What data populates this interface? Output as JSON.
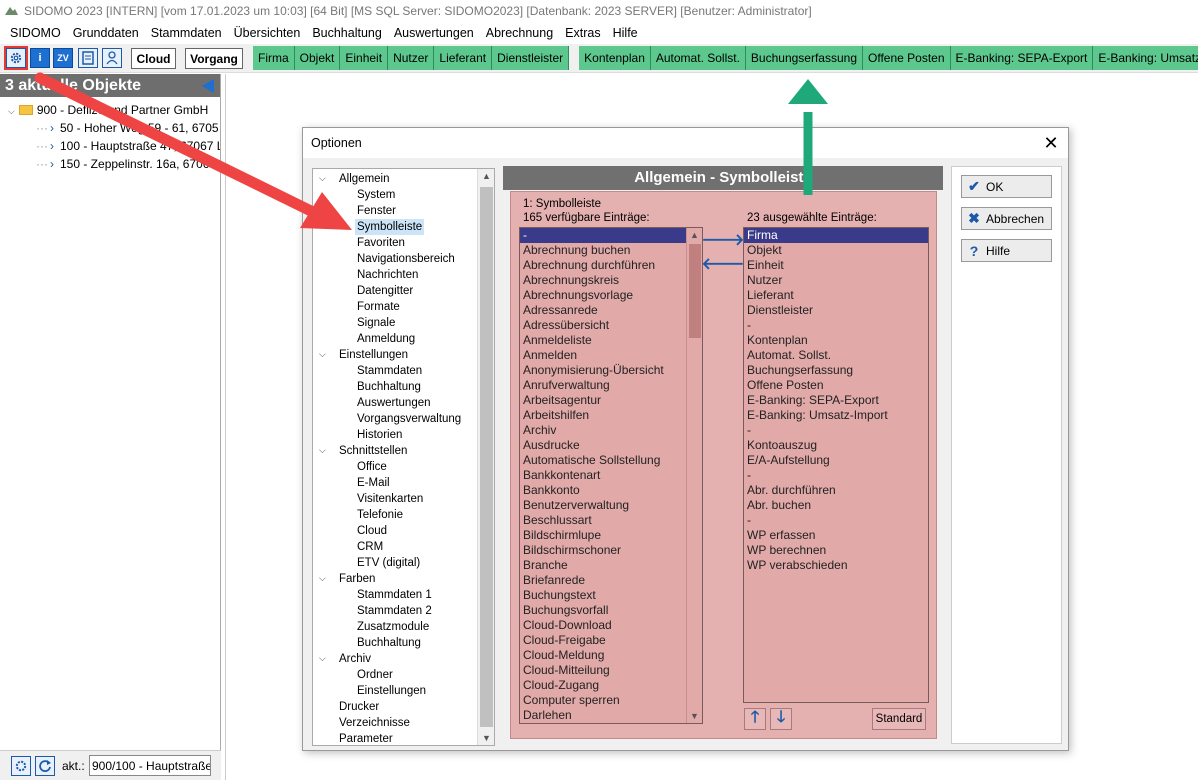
{
  "window": {
    "title": "SIDOMO 2023  [INTERN]  [vom 17.01.2023 um 10:03]  [64 Bit]  [MS SQL Server: SIDOMO2023]  [Datenbank: 2023 SERVER]  [Benutzer: Administrator]"
  },
  "menu": [
    "SIDOMO",
    "Grunddaten",
    "Stammdaten",
    "Übersichten",
    "Buchhaltung",
    "Auswertungen",
    "Abrechnung",
    "Extras",
    "Hilfe"
  ],
  "toolbar": {
    "icon_buttons": [
      {
        "icon": "gear-icon"
      },
      {
        "icon": "info-icon",
        "label": "i"
      },
      {
        "icon": "zv-icon",
        "label": "ZV"
      },
      {
        "icon": "calculator-icon"
      },
      {
        "icon": "user-icon"
      }
    ],
    "cloud_label": "Cloud",
    "vorgang_label": "Vorgang",
    "green_buttons": [
      "Firma",
      "Objekt",
      "Einheit",
      "Nutzer",
      "Lieferant",
      "Dienstleister",
      "-",
      "Kontenplan",
      "Automat. Sollst.",
      "Buchungserfassung",
      "Offene Posten",
      "E-Banking: SEPA-Export",
      "E-Banking: Umsatz-"
    ],
    "accent": "#5cc88e"
  },
  "left_panel": {
    "header": "3 aktuelle Objekte",
    "tree": [
      {
        "label": "900 - Deflize und Partner GmbH",
        "level": 0
      },
      {
        "label": "50 - Hoher Weg 59 - 61, 6705",
        "level": 1
      },
      {
        "label": "100 - Hauptstraße 47, 67067 L",
        "level": 1
      },
      {
        "label": "150 - Zeppelinstr. 16a, 6706",
        "level": 1
      }
    ],
    "akt_label": "akt.:",
    "akt_value": "900/100 - Hauptstraße"
  },
  "dialog": {
    "title": "Optionen",
    "tree": [
      {
        "label": "Allgemein",
        "level": 0,
        "expanded": true
      },
      {
        "label": "System",
        "level": 1
      },
      {
        "label": "Fenster",
        "level": 1
      },
      {
        "label": "Symbolleiste",
        "level": 1,
        "selected": true
      },
      {
        "label": "Favoriten",
        "level": 1
      },
      {
        "label": "Navigationsbereich",
        "level": 1
      },
      {
        "label": "Nachrichten",
        "level": 1
      },
      {
        "label": "Datengitter",
        "level": 1
      },
      {
        "label": "Formate",
        "level": 1
      },
      {
        "label": "Signale",
        "level": 1
      },
      {
        "label": "Anmeldung",
        "level": 1
      },
      {
        "label": "Einstellungen",
        "level": 0,
        "expanded": true
      },
      {
        "label": "Stammdaten",
        "level": 1
      },
      {
        "label": "Buchhaltung",
        "level": 1
      },
      {
        "label": "Auswertungen",
        "level": 1
      },
      {
        "label": "Vorgangsverwaltung",
        "level": 1
      },
      {
        "label": "Historien",
        "level": 1
      },
      {
        "label": "Schnittstellen",
        "level": 0,
        "expanded": true
      },
      {
        "label": "Office",
        "level": 1
      },
      {
        "label": "E-Mail",
        "level": 1
      },
      {
        "label": "Visitenkarten",
        "level": 1
      },
      {
        "label": "Telefonie",
        "level": 1
      },
      {
        "label": "Cloud",
        "level": 1
      },
      {
        "label": "CRM",
        "level": 1
      },
      {
        "label": "ETV (digital)",
        "level": 1
      },
      {
        "label": "Farben",
        "level": 0,
        "expanded": true
      },
      {
        "label": "Stammdaten 1",
        "level": 1
      },
      {
        "label": "Stammdaten 2",
        "level": 1
      },
      {
        "label": "Zusatzmodule",
        "level": 1
      },
      {
        "label": "Buchhaltung",
        "level": 1
      },
      {
        "label": "Archiv",
        "level": 0,
        "expanded": true
      },
      {
        "label": "Ordner",
        "level": 1
      },
      {
        "label": "Einstellungen",
        "level": 1
      },
      {
        "label": "Drucker",
        "level": 0
      },
      {
        "label": "Verzeichnisse",
        "level": 0
      },
      {
        "label": "Parameter",
        "level": 0
      }
    ],
    "content_header": "Allgemein - Symbolleiste",
    "group_label": "1: Symbolleiste",
    "available_label": "165 verfügbare Einträge:",
    "selected_label": "23 ausgewählte Einträge:",
    "available_items": [
      "-",
      "Abrechnung buchen",
      "Abrechnung durchführen",
      "Abrechnungskreis",
      "Abrechnungsvorlage",
      "Adressanrede",
      "Adressübersicht",
      "Anmeldeliste",
      "Anmelden",
      "Anonymisierung-Übersicht",
      "Anrufverwaltung",
      "Arbeitsagentur",
      "Arbeitshilfen",
      "Archiv",
      "Ausdrucke",
      "Automatische Sollstellung",
      "Bankkontenart",
      "Bankkonto",
      "Benutzerverwaltung",
      "Beschlussart",
      "Bildschirmlupe",
      "Bildschirmschoner",
      "Branche",
      "Briefanrede",
      "Buchungstext",
      "Buchungsvorfall",
      "Cloud-Download",
      "Cloud-Freigabe",
      "Cloud-Meldung",
      "Cloud-Mitteilung",
      "Cloud-Zugang",
      "Computer sperren",
      "Darlehen"
    ],
    "selected_items": [
      "Firma",
      "Objekt",
      "Einheit",
      "Nutzer",
      "Lieferant",
      "Dienstleister",
      "-",
      "Kontenplan",
      "Automat. Sollst.",
      "Buchungserfassung",
      "Offene Posten",
      "E-Banking: SEPA-Export",
      "E-Banking: Umsatz-Import",
      "-",
      "Kontoauszug",
      "E/A-Aufstellung",
      "-",
      "Abr. durchführen",
      "Abr. buchen",
      "-",
      "WP erfassen",
      "WP berechnen",
      "WP verabschieden"
    ],
    "standard_label": "Standard",
    "ok_label": "OK",
    "cancel_label": "Abbrechen",
    "help_label": "Hilfe",
    "panel_color": "#e4b0b0"
  }
}
